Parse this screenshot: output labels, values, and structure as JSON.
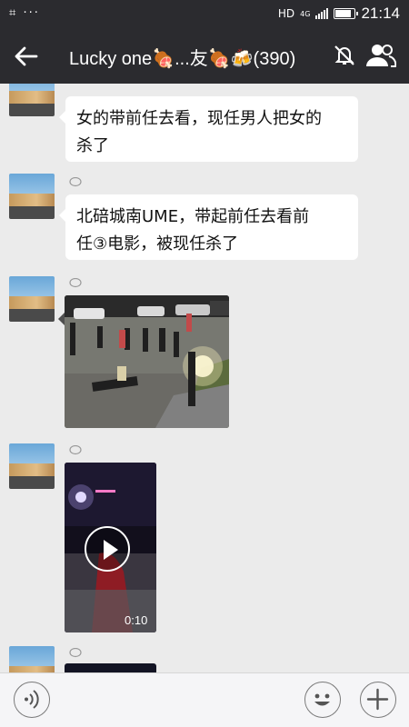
{
  "status_bar": {
    "left_icons": "⌗ ···",
    "network": "HD",
    "network_sub": "4G",
    "time": "21:14"
  },
  "header": {
    "title": "Lucky one🍖...友🍖🍻(390)",
    "icons": [
      "back-arrow-icon",
      "mute-icon",
      "members-icon"
    ]
  },
  "messages": [
    {
      "type": "text",
      "text_line1": "女的带前任去看，现任男人把女的",
      "text_line2": "杀了"
    },
    {
      "type": "text",
      "text_line1": "北碚城南UME，带起前任去看前",
      "text_line2": "任③电影，被现任杀了"
    },
    {
      "type": "image"
    },
    {
      "type": "video",
      "duration": "0:10"
    },
    {
      "type": "video"
    }
  ],
  "input_bar": {
    "icons": [
      "voice-icon",
      "emoji-icon",
      "plus-icon"
    ]
  },
  "colors": {
    "header_bg": "#2b2b2f",
    "chat_bg": "#ebebeb",
    "bubble_bg": "#ffffff"
  }
}
